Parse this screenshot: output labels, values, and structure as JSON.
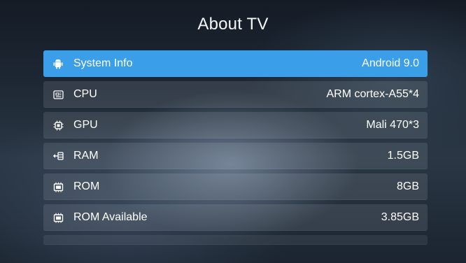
{
  "header": {
    "title": "About TV"
  },
  "rows": [
    {
      "label": "System Info",
      "value": "Android 9.0",
      "icon": "android-icon",
      "selected": true
    },
    {
      "label": "CPU",
      "value": "ARM cortex-A55*4",
      "icon": "cpu-icon",
      "selected": false
    },
    {
      "label": "GPU",
      "value": "Mali 470*3",
      "icon": "chip-icon",
      "selected": false
    },
    {
      "label": "RAM",
      "value": "1.5GB",
      "icon": "ram-icon",
      "selected": false
    },
    {
      "label": "ROM",
      "value": "8GB",
      "icon": "rom-icon",
      "selected": false
    },
    {
      "label": "ROM Available",
      "value": "3.85GB",
      "icon": "rom-icon",
      "selected": false
    }
  ],
  "colors": {
    "selected_background": "#3a9fe8",
    "text": "#ffffff"
  }
}
